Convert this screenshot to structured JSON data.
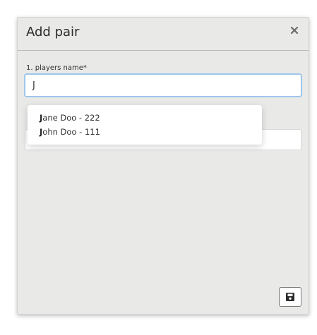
{
  "dialog": {
    "title": "Add pair",
    "close_icon": "close-icon",
    "field1": {
      "label": "1. players name*",
      "value": "J"
    },
    "suggestions": [
      {
        "match": "J",
        "rest": "ane Doo - 222"
      },
      {
        "match": "J",
        "rest": "ohn Doo - 111"
      }
    ],
    "save_icon": "save-icon"
  }
}
